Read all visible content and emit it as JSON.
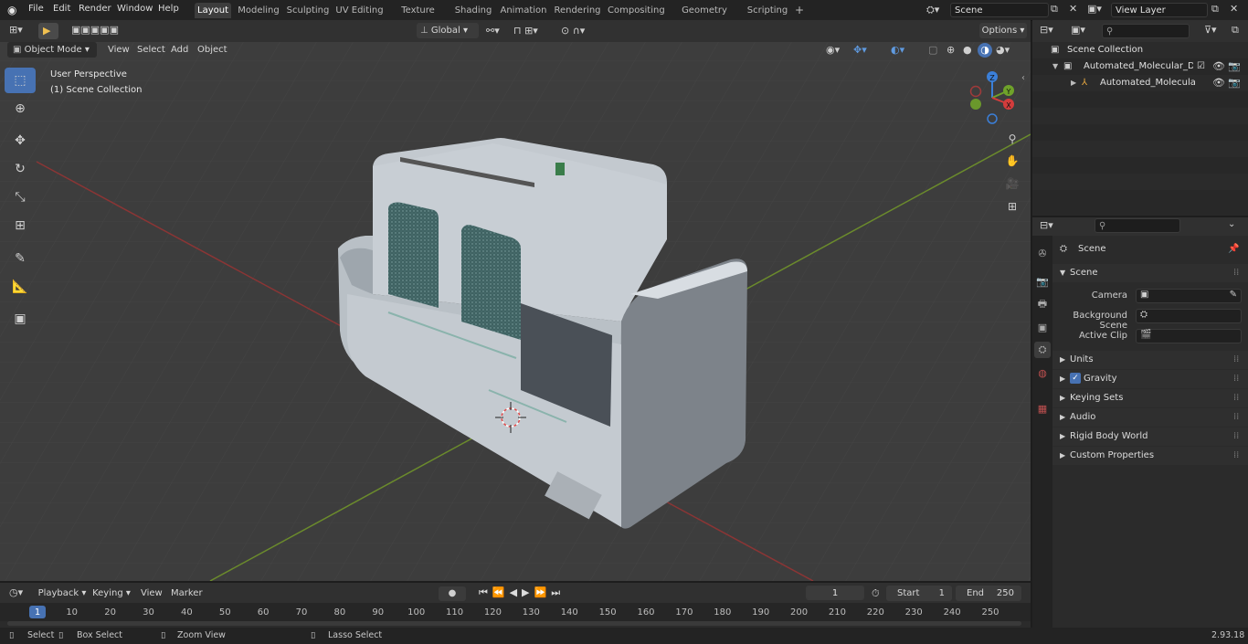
{
  "menu": {
    "items": [
      "File",
      "Edit",
      "Render",
      "Window",
      "Help"
    ]
  },
  "workspaces": {
    "tabs": [
      "Layout",
      "Modeling",
      "Sculpting",
      "UV Editing",
      "Texture Paint",
      "Shading",
      "Animation",
      "Rendering",
      "Compositing",
      "Geometry Nodes",
      "Scripting"
    ],
    "active": "Layout"
  },
  "scene_selector": {
    "value": "Scene"
  },
  "view_layer_selector": {
    "value": "View Layer"
  },
  "viewport_header": {
    "mode": "Object Mode",
    "menus": [
      "View",
      "Select",
      "Add",
      "Object"
    ],
    "transform_orientation": "Global",
    "options_label": "Options"
  },
  "viewport_overlay": {
    "perspective": "User Perspective",
    "collection": "(1) Scene Collection"
  },
  "gizmo": {
    "x": "X",
    "y": "Y",
    "z": "Z"
  },
  "outliner": {
    "root": "Scene Collection",
    "items": [
      {
        "label": "Automated_Molecular_Diagnc",
        "level": 1
      },
      {
        "label": "Automated_Molecular_Di",
        "level": 2
      }
    ]
  },
  "properties": {
    "header": "Scene",
    "section": "Scene",
    "fields": [
      {
        "label": "Camera"
      },
      {
        "label": "Background Scene"
      },
      {
        "label": "Active Clip"
      }
    ],
    "panels": [
      "Units",
      "Gravity",
      "Keying Sets",
      "Audio",
      "Rigid Body World",
      "Custom Properties"
    ],
    "gravity_checked": true
  },
  "timeline": {
    "menus": [
      "Playback",
      "Keying",
      "View",
      "Marker"
    ],
    "current_frame": "1",
    "start_label": "Start",
    "start_value": "1",
    "end_label": "End",
    "end_value": "250",
    "ticks": [
      "1",
      "10",
      "20",
      "30",
      "40",
      "50",
      "60",
      "70",
      "80",
      "90",
      "100",
      "110",
      "120",
      "130",
      "140",
      "150",
      "160",
      "170",
      "180",
      "190",
      "200",
      "210",
      "220",
      "230",
      "240",
      "250"
    ]
  },
  "statusbar": {
    "select": "Select",
    "box_select": "Box Select",
    "zoom_view": "Zoom View",
    "lasso_select": "Lasso Select",
    "version": "2.93.18"
  },
  "colors": {
    "accent": "#4772b3",
    "axis_x": "#c13b3b",
    "axis_y": "#7ba33a"
  }
}
